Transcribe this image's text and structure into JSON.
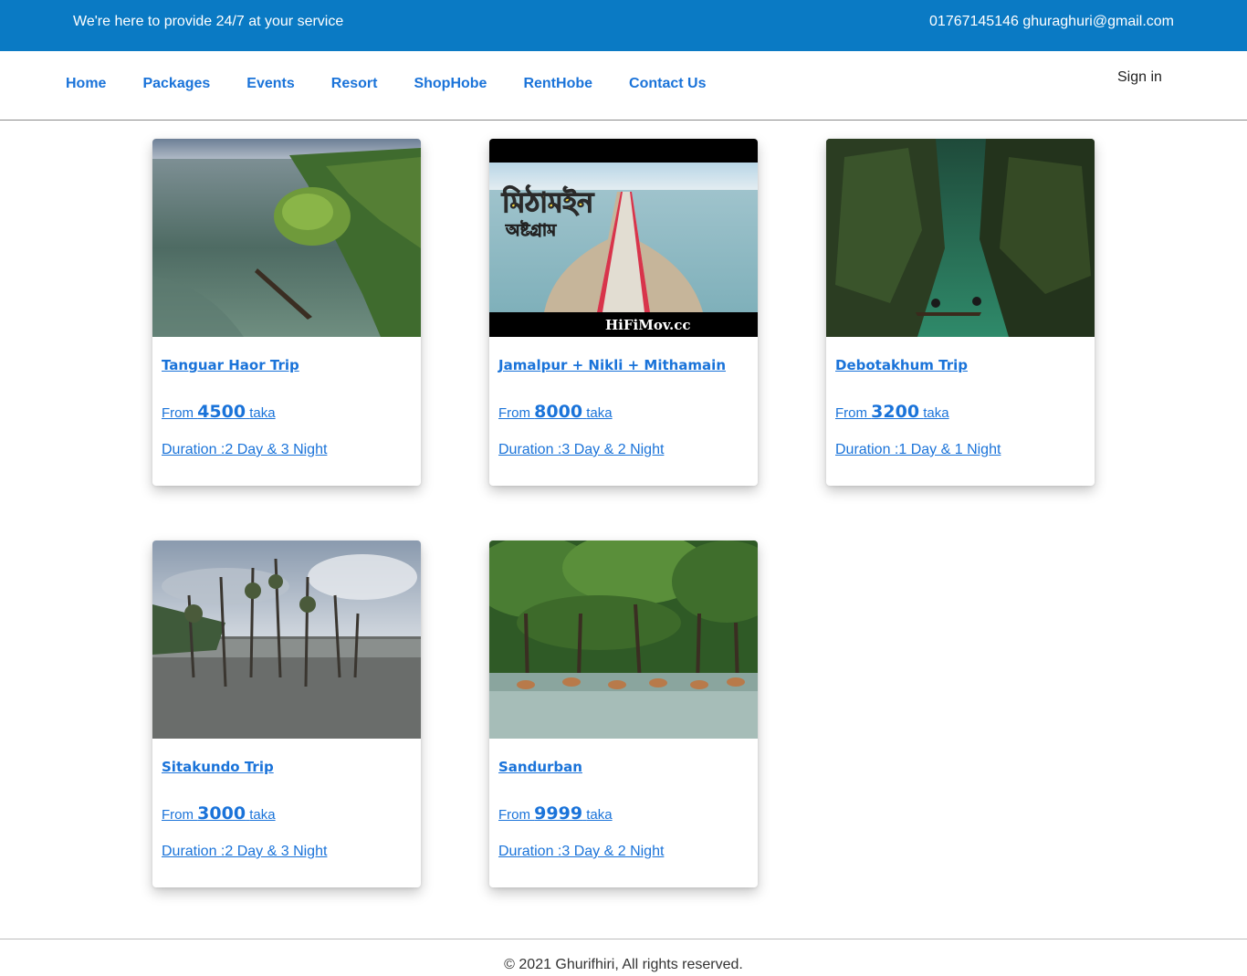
{
  "topbar": {
    "tagline": "We're here to provide 24/7 at your service",
    "contact": "01767145146 ghuraghuri@gmail.com"
  },
  "nav": {
    "links": [
      "Home",
      "Packages",
      "Events",
      "Resort",
      "ShopHobe",
      "RentHobe",
      "Contact Us"
    ],
    "signin": "Sign in"
  },
  "packages": [
    {
      "title": "Tanguar Haor Trip",
      "price_prefix": "From",
      "price": "4500",
      "price_suffix": "taka",
      "duration": "Duration :2 Day & 3 Night"
    },
    {
      "title": "Jamalpur + Nikli + Mithamain",
      "price_prefix": "From",
      "price": "8000",
      "price_suffix": "taka",
      "duration": "Duration :3 Day & 2 Night",
      "image_text_bn": "মিঠামইন",
      "image_text_bn_sub": "অষ্টগ্রাম",
      "image_watermark": "HiFiMov.cc"
    },
    {
      "title": "Debotakhum Trip",
      "price_prefix": "From",
      "price": "3200",
      "price_suffix": "taka",
      "duration": "Duration :1 Day & 1 Night"
    },
    {
      "title": "Sitakundo Trip",
      "price_prefix": "From",
      "price": "3000",
      "price_suffix": "taka",
      "duration": "Duration :2 Day & 3 Night"
    },
    {
      "title": "Sandurban",
      "price_prefix": "From",
      "price": "9999",
      "price_suffix": "taka",
      "duration": "Duration :3 Day & 2 Night"
    }
  ],
  "footer": {
    "copyright": "© 2021 Ghurifhiri, All rights reserved."
  },
  "colors": {
    "topbar": "#0a7ac4",
    "link": "#1a73d9"
  }
}
